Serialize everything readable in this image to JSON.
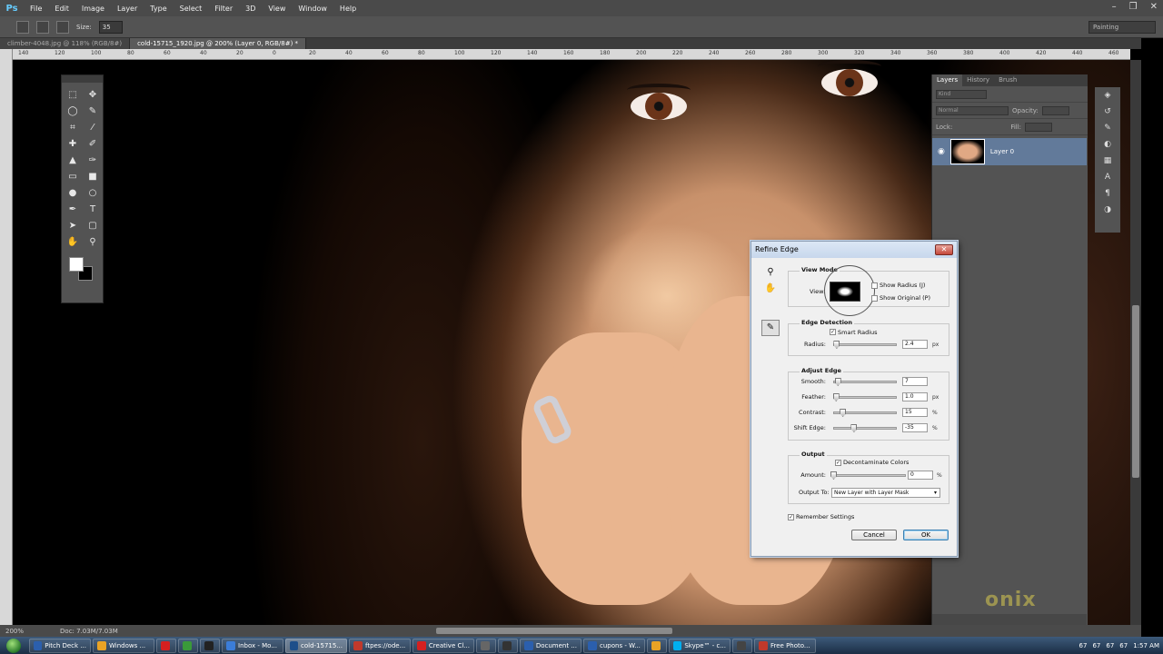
{
  "app": {
    "logo": "Ps",
    "menus": [
      "File",
      "Edit",
      "Image",
      "Layer",
      "Type",
      "Select",
      "Filter",
      "3D",
      "View",
      "Window",
      "Help"
    ],
    "workspace": "Painting"
  },
  "options": {
    "size_label": "Size:",
    "size_value": "35"
  },
  "tabs": [
    {
      "label": "climber-4048.jpg @ 118% (RGB/8#)"
    },
    {
      "label": "cold-15715_1920.jpg @ 200% (Layer 0, RGB/8#) *"
    }
  ],
  "ruler": {
    "ticks": [
      "140",
      "120",
      "100",
      "80",
      "60",
      "40",
      "20",
      "0",
      "20",
      "40",
      "60",
      "80",
      "100",
      "120",
      "140",
      "160",
      "180",
      "200",
      "220",
      "240",
      "260",
      "280",
      "300",
      "320",
      "340",
      "360",
      "380",
      "400",
      "420",
      "440",
      "460",
      "480"
    ]
  },
  "layers_panel": {
    "tabs": [
      "Layers",
      "History",
      "Brush"
    ],
    "kind": "Kind",
    "blend": "Normal",
    "opacity_label": "Opacity:",
    "lock_label": "Lock:",
    "fill_label": "Fill:",
    "layer_name": "Layer 0"
  },
  "status": {
    "zoom": "200%",
    "doc": "Doc: 7.03M/7.03M"
  },
  "dialog": {
    "title": "Refine Edge",
    "close": "✕",
    "view_mode": {
      "title": "View Mode",
      "view_label": "View:",
      "show_radius": "Show Radius (J)",
      "show_original": "Show Original (P)"
    },
    "edge_detection": {
      "title": "Edge Detection",
      "smart_radius": "Smart Radius",
      "radius_label": "Radius:",
      "radius_value": "2.4",
      "radius_unit": "px",
      "radius_level": 0.05
    },
    "adjust_edge": {
      "title": "Adjust Edge",
      "smooth_label": "Smooth:",
      "smooth_value": "7",
      "smooth_level": 0.07,
      "feather_label": "Feather:",
      "feather_value": "1.0",
      "feather_unit": "px",
      "feather_level": 0.04,
      "contrast_label": "Contrast:",
      "contrast_value": "15",
      "contrast_unit": "%",
      "contrast_level": 0.15,
      "shift_label": "Shift Edge:",
      "shift_value": "-35",
      "shift_unit": "%",
      "shift_level": 0.33
    },
    "output": {
      "title": "Output",
      "decontaminate": "Decontaminate Colors",
      "amount_label": "Amount:",
      "amount_value": "0",
      "amount_unit": "%",
      "amount_level": 0.0,
      "output_to_label": "Output To:",
      "output_to_value": "New Layer with Layer Mask"
    },
    "remember": "Remember Settings",
    "cancel": "Cancel",
    "ok": "OK"
  },
  "taskbar": {
    "items": [
      {
        "label": "Pitch Deck ...",
        "color": "#2b5fad"
      },
      {
        "label": "Windows ...",
        "color": "#e9a325"
      },
      {
        "label": "",
        "color": "#d42020"
      },
      {
        "label": "",
        "color": "#3a9a3a"
      },
      {
        "label": "",
        "color": "#222222"
      },
      {
        "label": "Inbox - Mo...",
        "color": "#3b7dd8"
      },
      {
        "label": "cold-15715...",
        "color": "#1e4f8a"
      },
      {
        "label": "ftpes://ode...",
        "color": "#c0392b"
      },
      {
        "label": "Creative Cl...",
        "color": "#d42020"
      },
      {
        "label": "",
        "color": "#666666"
      },
      {
        "label": "",
        "color": "#333333"
      },
      {
        "label": "Document ...",
        "color": "#2b5fad"
      },
      {
        "label": "cupons - W...",
        "color": "#2b5fad"
      },
      {
        "label": "",
        "color": "#e9a325"
      },
      {
        "label": "Skype™ - c...",
        "color": "#00aff0"
      },
      {
        "label": "",
        "color": "#444444"
      },
      {
        "label": "Free Photo...",
        "color": "#c0392b"
      }
    ],
    "tray_nums": [
      "67",
      "67",
      "67",
      "67"
    ],
    "clock": "1:57 AM"
  },
  "watermark": "onix"
}
